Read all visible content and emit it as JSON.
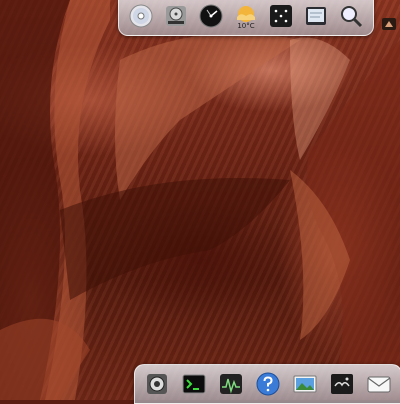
{
  "top_dock": {
    "apps": [
      {
        "name": "dvd-player-icon"
      },
      {
        "name": "disk-utility-icon"
      },
      {
        "name": "dashboard-icon"
      },
      {
        "name": "weather-widget-icon",
        "temperature": "10°C"
      },
      {
        "name": "spaces-icon"
      },
      {
        "name": "notes-icon"
      },
      {
        "name": "search-icon"
      }
    ]
  },
  "bottom_dock": {
    "apps": [
      {
        "name": "preview-icon"
      },
      {
        "name": "terminal-icon"
      },
      {
        "name": "activity-monitor-icon"
      },
      {
        "name": "help-icon"
      },
      {
        "name": "iphoto-icon"
      },
      {
        "name": "photo-booth-icon"
      },
      {
        "name": "mail-icon"
      }
    ]
  },
  "colors": {
    "wallpaper_base": "#6b2314",
    "dock": "#c8c8d0"
  }
}
